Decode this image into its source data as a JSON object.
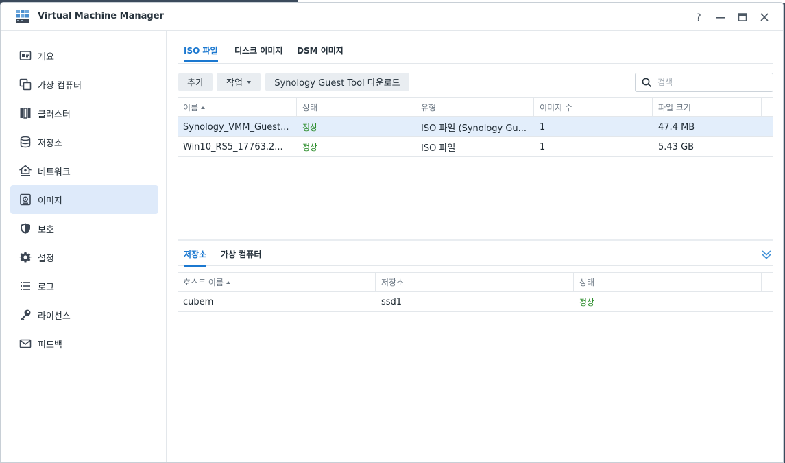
{
  "window": {
    "title": "Virtual Machine Manager",
    "controls": [
      "help-icon",
      "minimize-icon",
      "maximize-icon",
      "close-icon"
    ]
  },
  "sidebar": {
    "items": [
      {
        "label": "개요",
        "icon": "overview-icon"
      },
      {
        "label": "가상 컴퓨터",
        "icon": "virtual-machine-icon"
      },
      {
        "label": "클러스터",
        "icon": "cluster-icon"
      },
      {
        "label": "저장소",
        "icon": "storage-icon"
      },
      {
        "label": "네트워크",
        "icon": "network-icon"
      },
      {
        "label": "이미지",
        "icon": "image-icon",
        "active": true
      },
      {
        "label": "보호",
        "icon": "shield-icon"
      },
      {
        "label": "설정",
        "icon": "gear-icon"
      },
      {
        "label": "로그",
        "icon": "log-list-icon"
      },
      {
        "label": "라이선스",
        "icon": "key-icon"
      },
      {
        "label": "피드백",
        "icon": "mail-icon"
      }
    ]
  },
  "tabs": [
    {
      "label": "ISO 파일",
      "active": true
    },
    {
      "label": "디스크 이미지"
    },
    {
      "label": "DSM 이미지"
    }
  ],
  "toolbar": {
    "add_label": "추가",
    "action_label": "작업",
    "download_label": "Synology Guest Tool 다운로드",
    "search_placeholder": "검색"
  },
  "iso_table": {
    "columns": [
      "이름",
      "상태",
      "유형",
      "이미지 수",
      "파일 크기"
    ],
    "rows": [
      {
        "name": "Synology_VMM_Guest...",
        "status": "정상",
        "type": "ISO 파일 (Synology Gu...",
        "count": "1",
        "size": "47.4 MB",
        "selected": true
      },
      {
        "name": "Win10_RS5_17763.2...",
        "status": "정상",
        "type": "ISO 파일",
        "count": "1",
        "size": "5.43 GB"
      }
    ]
  },
  "bottom_tabs": [
    {
      "label": "저장소",
      "active": true
    },
    {
      "label": "가상 컴퓨터"
    }
  ],
  "host_table": {
    "columns": [
      "호스트 이름",
      "저장소",
      "상태"
    ],
    "rows": [
      {
        "host": "cubem",
        "storage": "ssd1",
        "status": "정상"
      }
    ]
  },
  "colors": {
    "accent": "#1b78d0",
    "status_ok": "#2a8c2a",
    "selected_row": "#e3eefb",
    "active_nav": "#deeafa"
  }
}
